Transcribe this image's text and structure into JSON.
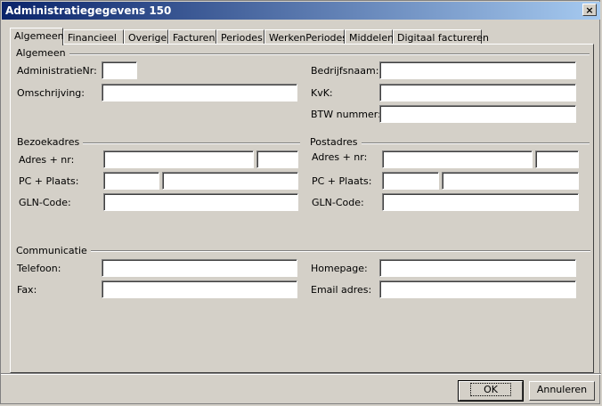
{
  "window": {
    "title": "Administratiegegevens 150",
    "close_label": "×"
  },
  "tabs": [
    {
      "label": "Algemeen"
    },
    {
      "label": "Financieel"
    },
    {
      "label": "Overige"
    },
    {
      "label": "Facturen"
    },
    {
      "label": "Periodes"
    },
    {
      "label": "WerkenPeriodes"
    },
    {
      "label": "Middelen"
    },
    {
      "label": "Digitaal factureren"
    }
  ],
  "active_tab": "Algemeen",
  "algemeen": {
    "title": "Algemeen",
    "administratie_nr_label": "AdministratieNr:",
    "omschrijving_label": "Omschrijving:",
    "bedrijfsnaam_label": "Bedrijfsnaam:",
    "kvk_label": "KvK:",
    "btw_label": "BTW nummer:"
  },
  "bezoekadres": {
    "title": "Bezoekadres",
    "adres_label": "Adres + nr:",
    "pc_label": "PC + Plaats:",
    "gln_label": "GLN-Code:"
  },
  "postadres": {
    "title": "Postadres",
    "adres_label": "Adres + nr:",
    "pc_label": "PC + Plaats:",
    "gln_label": "GLN-Code:"
  },
  "communicatie": {
    "title": "Communicatie",
    "telefoon_label": "Telefoon:",
    "fax_label": "Fax:",
    "homepage_label": "Homepage:",
    "email_label": "Email adres:"
  },
  "buttons": {
    "ok_label": "OK",
    "cancel_label": "Annuleren"
  }
}
